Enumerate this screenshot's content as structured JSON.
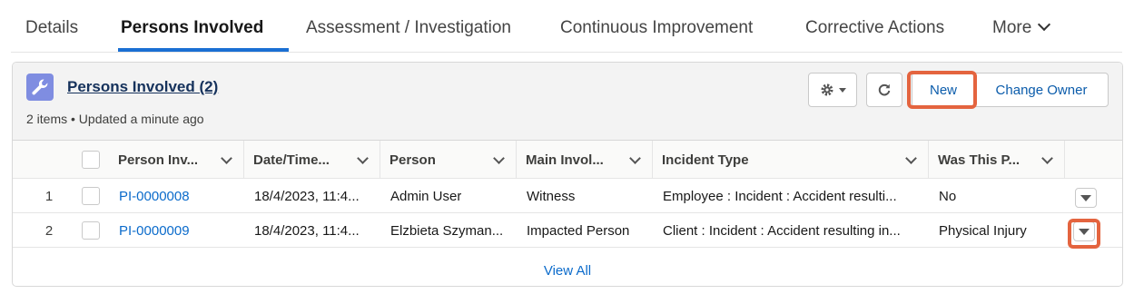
{
  "tabs": [
    {
      "label": "Details"
    },
    {
      "label": "Persons Involved"
    },
    {
      "label": "Assessment / Investigation"
    },
    {
      "label": "Continuous Improvement"
    },
    {
      "label": "Corrective Actions"
    },
    {
      "label": "More"
    }
  ],
  "active_tab": "Persons Involved",
  "card": {
    "icon": "wrench-icon",
    "title": "Persons Involved (2)",
    "subtitle": "2 items • Updated a minute ago",
    "buttons": {
      "new_label": "New",
      "change_owner_label": "Change Owner"
    }
  },
  "table": {
    "columns": [
      {
        "label": "Person Inv..."
      },
      {
        "label": "Date/Time..."
      },
      {
        "label": "Person"
      },
      {
        "label": "Main Invol..."
      },
      {
        "label": "Incident Type"
      },
      {
        "label": "Was This P..."
      }
    ],
    "rows": [
      {
        "num": "1",
        "record": "PI-0000008",
        "datetime": "18/4/2023, 11:4...",
        "person": "Admin User",
        "main_involvement": "Witness",
        "incident_type": "Employee : Incident : Accident resulti...",
        "was_this": "No"
      },
      {
        "num": "2",
        "record": "PI-0000009",
        "datetime": "18/4/2023, 11:4...",
        "person": "Elzbieta Szyman...",
        "main_involvement": "Impacted Person",
        "incident_type": "Client : Incident : Accident resulting in...",
        "was_this": "Physical Injury"
      }
    ],
    "view_all_label": "View All"
  },
  "colors": {
    "accent": "#1b6fd3",
    "link": "#0b6bcb",
    "highlight": "#e4643f",
    "object_icon": "#7f8de1"
  }
}
